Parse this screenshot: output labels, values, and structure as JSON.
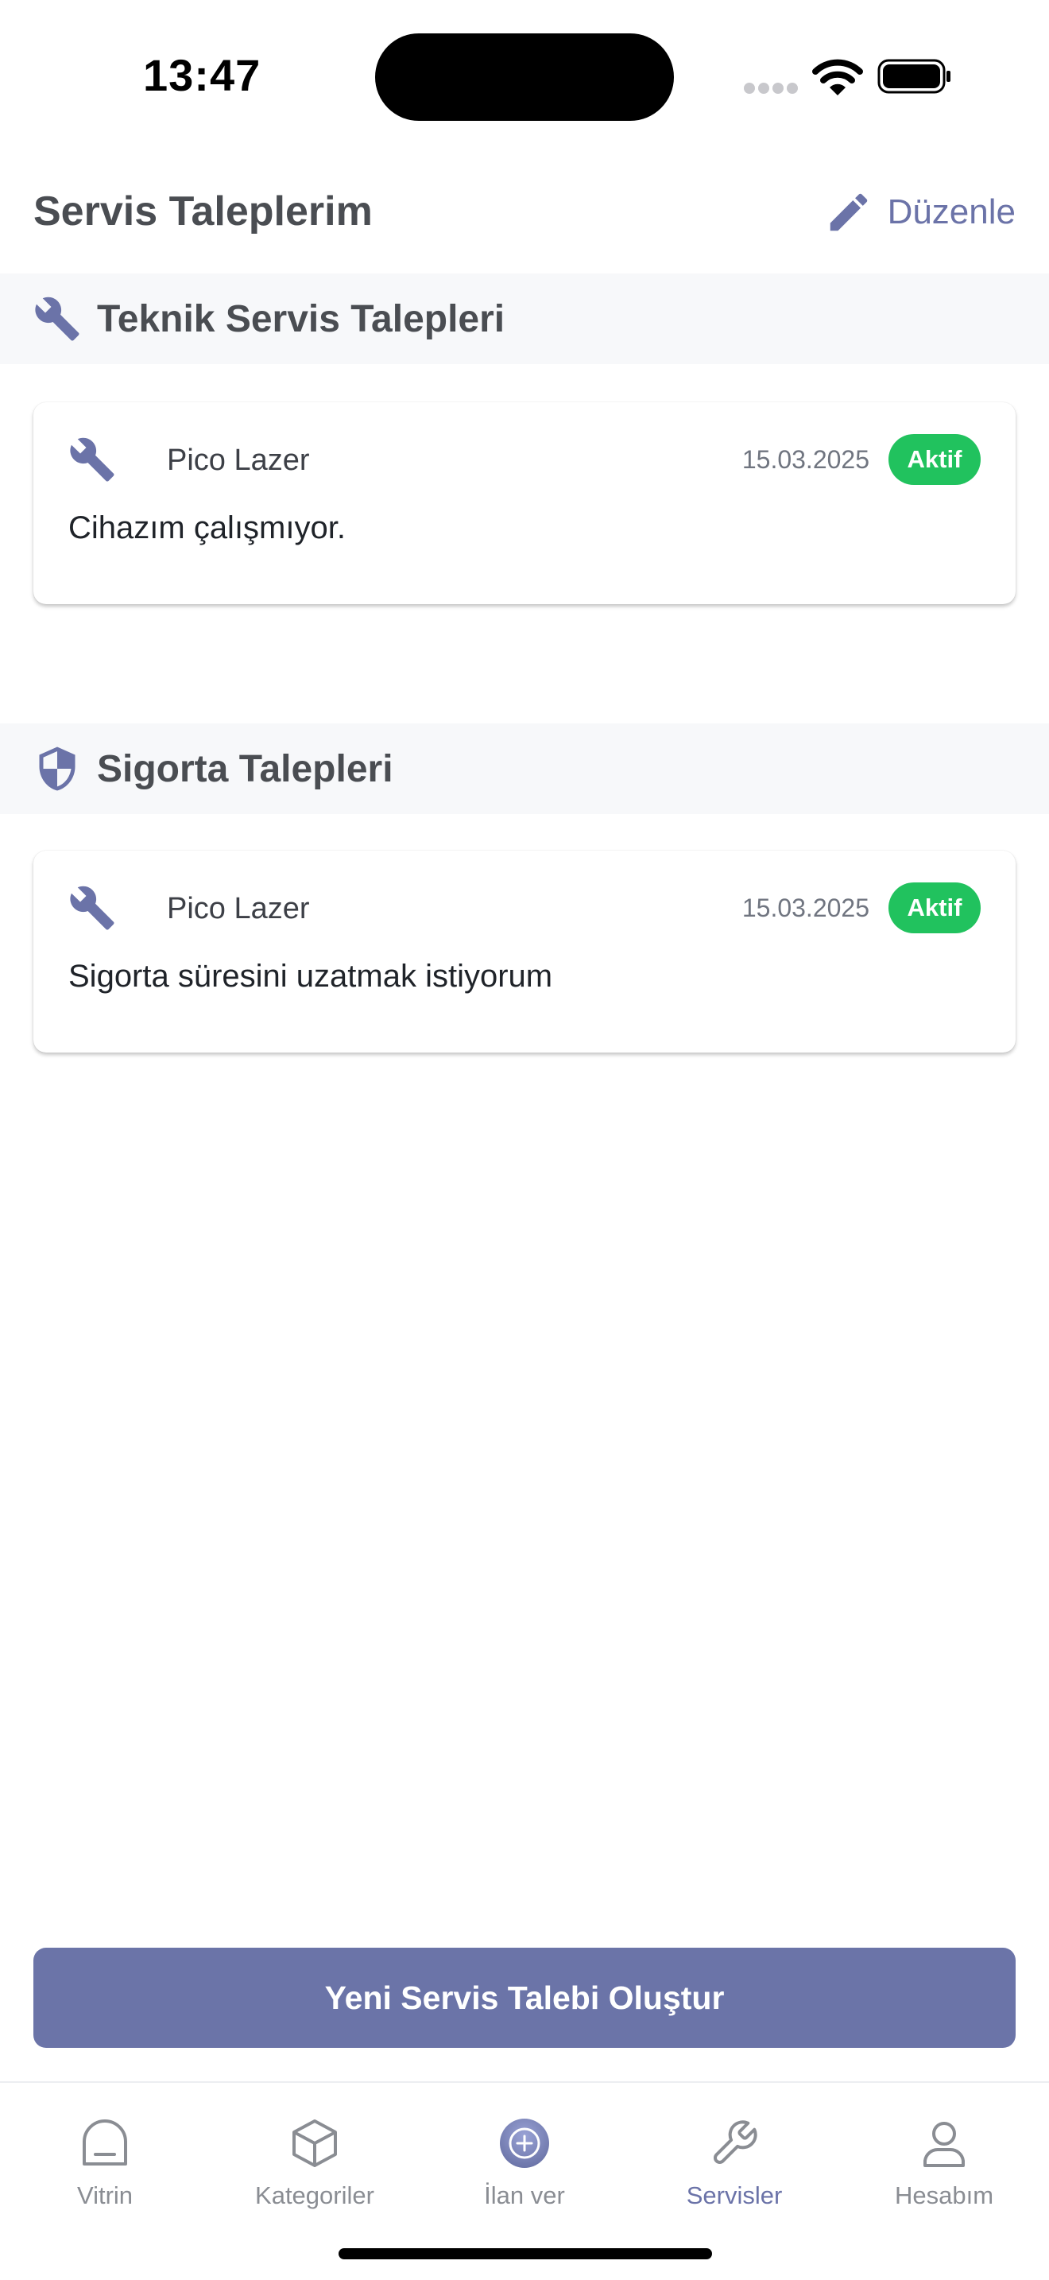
{
  "status_bar": {
    "time": "13:47"
  },
  "header": {
    "title": "Servis Taleplerim",
    "edit_label": "Düzenle"
  },
  "sections": [
    {
      "title": "Teknik Servis Talepleri",
      "icon": "wrench-icon",
      "requests": [
        {
          "device": "Pico Lazer",
          "date": "15.03.2025",
          "status": "Aktif",
          "description": "Cihazım çalışmıyor."
        }
      ]
    },
    {
      "title": "Sigorta Talepleri",
      "icon": "shield-icon",
      "requests": [
        {
          "device": "Pico Lazer",
          "date": "15.03.2025",
          "status": "Aktif",
          "description": "Sigorta süresini uzatmak istiyorum"
        }
      ]
    }
  ],
  "create_button_label": "Yeni Servis Talebi Oluştur",
  "tab_bar": {
    "tabs": [
      {
        "label": "Vitrin",
        "icon": "home-icon"
      },
      {
        "label": "Kategoriler",
        "icon": "box-icon"
      },
      {
        "label": "İlan ver",
        "icon": "plus-circle-icon"
      },
      {
        "label": "Servisler",
        "icon": "wrench-icon"
      },
      {
        "label": "Hesabım",
        "icon": "user-icon"
      }
    ],
    "active": "Servisler"
  },
  "colors": {
    "accent": "#6b73a8",
    "status_active": "#21c25e",
    "section_bg": "#f7f8fa",
    "heading_text": "#4a4d52"
  }
}
